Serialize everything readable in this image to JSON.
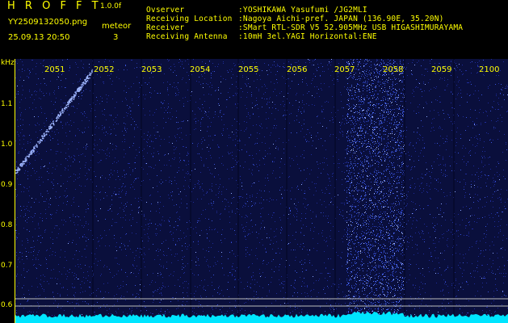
{
  "header": {
    "app_title": "H R O F F T",
    "version": "1.0.0f",
    "filename": "YY2509132050.png",
    "datetime": "25.09.13 20:50",
    "meteor_label": "meteor",
    "meteor_count": "3",
    "info_labels": [
      "Ovserver",
      "Receiving Location",
      "Receiver",
      "Receiving Antenna"
    ],
    "info_values": [
      ":YOSHIKAWA Yasufumi /JG2MLI",
      ":Nagoya Aichi-pref. JAPAN (136.90E, 35.20N)",
      ":SMart RTL-SDR V5 52.905MHz USB HIGASHIMURAYAMA",
      ":10mH 3el.YAGI Horizontal:ENE"
    ]
  },
  "y_axis": {
    "unit": "kHz",
    "ticks": [
      "1.1",
      "1.0",
      "0.9",
      "0.8",
      "0.7",
      "0.6"
    ]
  },
  "x_axis": {
    "ticks": [
      "2051",
      "2052",
      "2053",
      "2054",
      "2055",
      "2056",
      "2057",
      "2058",
      "2059",
      "2100"
    ]
  },
  "colors": {
    "text": "#ffff00",
    "background": "#0a0f3c",
    "signal": "#3a6bff",
    "noise_floor": "#00e5ff",
    "guide_line": "#bcbcbc"
  }
}
